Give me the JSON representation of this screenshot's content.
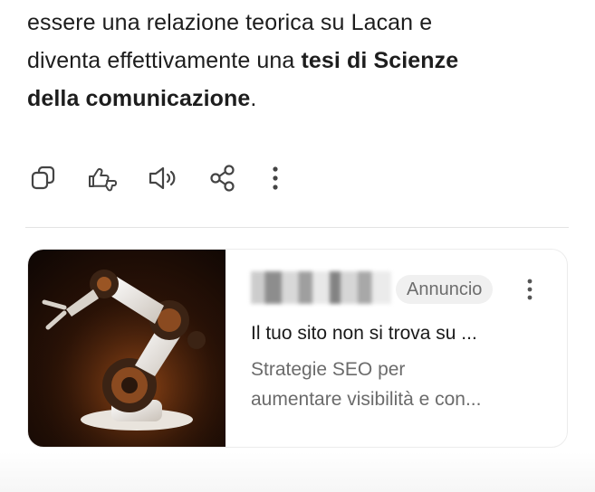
{
  "message": {
    "line1": "essere una relazione teorica su Lacan e",
    "line2_normal": "diventa effettivamente una ",
    "line2_bold": "tesi di Scienze",
    "line3_bold": "della comunicazione",
    "line3_end": "."
  },
  "actions": [
    {
      "name": "copy-icon"
    },
    {
      "name": "thumbs-feedback-icon"
    },
    {
      "name": "speaker-icon"
    },
    {
      "name": "share-icon"
    },
    {
      "name": "more-vertical-icon"
    }
  ],
  "ad": {
    "badge": "Annuncio",
    "title": "Il tuo sito non si trova su ...",
    "desc_line1": "Strategie SEO per",
    "desc_line2": "aumentare visibilità e con...",
    "image": "robotic-arm-image"
  },
  "colors": {
    "text": "#1d1d1d",
    "muted": "#6b6b6b",
    "badge_bg": "#f0f0f0",
    "divider": "#e3e3e3"
  }
}
